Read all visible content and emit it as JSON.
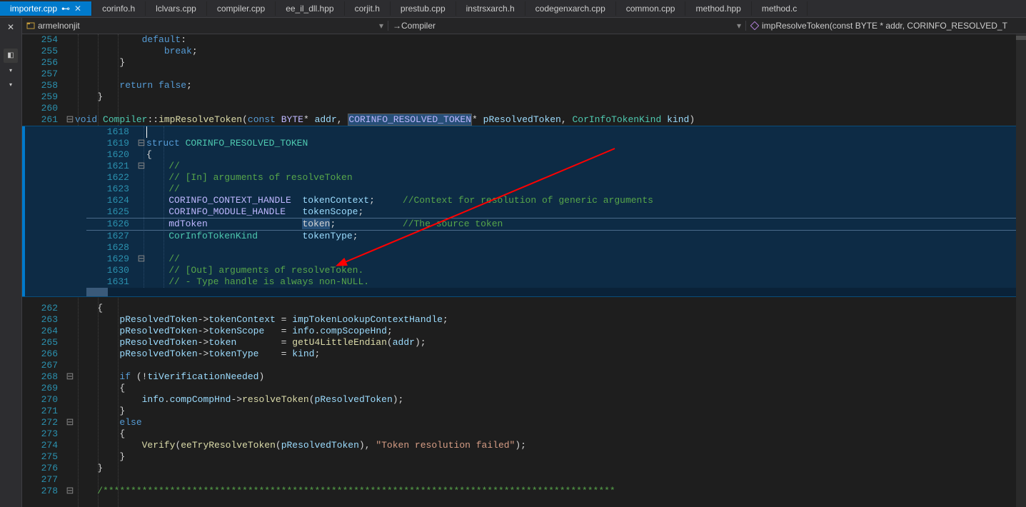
{
  "tabs": [
    {
      "label": "importer.cpp",
      "active": true,
      "pinned": true,
      "close": true
    },
    {
      "label": "corinfo.h"
    },
    {
      "label": "lclvars.cpp"
    },
    {
      "label": "compiler.cpp"
    },
    {
      "label": "ee_il_dll.hpp"
    },
    {
      "label": "corjit.h"
    },
    {
      "label": "prestub.cpp"
    },
    {
      "label": "instrsxarch.h"
    },
    {
      "label": "codegenxarch.cpp"
    },
    {
      "label": "common.cpp"
    },
    {
      "label": "method.hpp"
    },
    {
      "label": "method.c"
    }
  ],
  "nav": {
    "project": "armelnonjit",
    "class_prefix": "→ ",
    "class": "Compiler",
    "member": "impResolveToken(const BYTE * addr, CORINFO_RESOLVED_T"
  },
  "outer": {
    "lines": [
      {
        "num": "254",
        "fold": "",
        "indent": 3,
        "html": "<span class='kw'>default</span>:"
      },
      {
        "num": "255",
        "fold": "",
        "indent": 4,
        "html": "<span class='kw'>break</span>;"
      },
      {
        "num": "256",
        "fold": "",
        "indent": 2,
        "html": "}"
      },
      {
        "num": "257",
        "fold": "",
        "indent": 0,
        "html": ""
      },
      {
        "num": "258",
        "fold": "",
        "indent": 2,
        "html": "<span class='kw'>return</span> <span class='kw'>false</span>;"
      },
      {
        "num": "259",
        "fold": "",
        "indent": 1,
        "html": "}"
      },
      {
        "num": "260",
        "fold": "",
        "indent": 0,
        "html": ""
      },
      {
        "num": "261",
        "fold": "⊟",
        "indent": 0,
        "html": "<span class='kw'>void</span> <span class='type'>Compiler</span>::<span class='fn'>impResolveToken</span>(<span class='kw'>const</span> <span class='mac'>BYTE</span>* <span class='id'>addr</span>, <span class='hl'><span class='mac'>CORINFO_RESOLVED_TOKEN</span></span>* <span class='id'>pResolvedToken</span>, <span class='type'>CorInfoTokenKind</span> <span class='id'>kind</span>)"
      }
    ],
    "lines2": [
      {
        "num": "262",
        "fold": "",
        "indent": 1,
        "html": "{"
      },
      {
        "num": "263",
        "fold": "",
        "indent": 2,
        "html": "<span class='id'>pResolvedToken</span>-&gt;<span class='id'>tokenContext</span> = <span class='id'>impTokenLookupContextHandle</span>;"
      },
      {
        "num": "264",
        "fold": "",
        "indent": 2,
        "html": "<span class='id'>pResolvedToken</span>-&gt;<span class='id'>tokenScope</span>   = <span class='id'>info</span>.<span class='id'>compScopeHnd</span>;"
      },
      {
        "num": "265",
        "fold": "",
        "indent": 2,
        "html": "<span class='id'>pResolvedToken</span>-&gt;<span class='id'>token</span>        = <span class='fn'>getU4LittleEndian</span>(<span class='id'>addr</span>);"
      },
      {
        "num": "266",
        "fold": "",
        "indent": 2,
        "html": "<span class='id'>pResolvedToken</span>-&gt;<span class='id'>tokenType</span>    = <span class='id'>kind</span>;"
      },
      {
        "num": "267",
        "fold": "",
        "indent": 0,
        "html": ""
      },
      {
        "num": "268",
        "fold": "⊟",
        "indent": 2,
        "html": "<span class='kw'>if</span> (!<span class='id'>tiVerificationNeeded</span>)"
      },
      {
        "num": "269",
        "fold": "",
        "indent": 2,
        "html": "{"
      },
      {
        "num": "270",
        "fold": "",
        "indent": 3,
        "html": "<span class='id'>info</span>.<span class='id'>compCompHnd</span>-&gt;<span class='fn'>resolveToken</span>(<span class='id'>pResolvedToken</span>);"
      },
      {
        "num": "271",
        "fold": "",
        "indent": 2,
        "html": "}"
      },
      {
        "num": "272",
        "fold": "⊟",
        "indent": 2,
        "html": "<span class='kw'>else</span>"
      },
      {
        "num": "273",
        "fold": "",
        "indent": 2,
        "html": "{"
      },
      {
        "num": "274",
        "fold": "",
        "indent": 3,
        "html": "<span class='fn'>Verify</span>(<span class='fn'>eeTryResolveToken</span>(<span class='id'>pResolvedToken</span>), <span class='str'>\"Token resolution failed\"</span>);"
      },
      {
        "num": "275",
        "fold": "",
        "indent": 2,
        "html": "}"
      },
      {
        "num": "276",
        "fold": "",
        "indent": 1,
        "html": "}"
      },
      {
        "num": "277",
        "fold": "",
        "indent": 0,
        "html": ""
      },
      {
        "num": "278",
        "fold": "⊟",
        "indent": 1,
        "html": "<span class='cm'>/********************************************************************************************</span>"
      }
    ]
  },
  "peek": {
    "lines": [
      {
        "num": "1618",
        "fold": "",
        "indent": 0,
        "html": "",
        "cursor": true
      },
      {
        "num": "1619",
        "fold": "⊟",
        "indent": 0,
        "html": "<span class='kw'>struct</span> <span class='type'>CORINFO_RESOLVED_TOKEN</span>"
      },
      {
        "num": "1620",
        "fold": "",
        "indent": 0,
        "html": "{"
      },
      {
        "num": "1621",
        "fold": "⊟",
        "indent": 1,
        "html": "<span class='cm'>//</span>"
      },
      {
        "num": "1622",
        "fold": "",
        "indent": 1,
        "html": "<span class='cm'>// [In] arguments of resolveToken</span>"
      },
      {
        "num": "1623",
        "fold": "",
        "indent": 1,
        "html": "<span class='cm'>//</span>"
      },
      {
        "num": "1624",
        "fold": "",
        "indent": 1,
        "html": "<span class='mac'>CORINFO_CONTEXT_HANDLE</span>  <span class='id'>tokenContext</span>;     <span class='cm'>//Context for resolution of generic arguments</span>"
      },
      {
        "num": "1625",
        "fold": "",
        "indent": 1,
        "html": "<span class='mac'>CORINFO_MODULE_HANDLE</span>   <span class='id'>tokenScope</span>;"
      },
      {
        "num": "1626",
        "fold": "",
        "indent": 1,
        "html": "<span class='mac'>mdToken</span>                 <span class='sel'>tok</span><span class='sel'>en</span>;            <span class='cm'>//The source token</span>",
        "hl": true
      },
      {
        "num": "1627",
        "fold": "",
        "indent": 1,
        "html": "<span class='type'>CorInfoTokenKind</span>        <span class='id'>tokenType</span>;"
      },
      {
        "num": "1628",
        "fold": "",
        "indent": 0,
        "html": ""
      },
      {
        "num": "1629",
        "fold": "⊟",
        "indent": 1,
        "html": "<span class='cm'>//</span>"
      },
      {
        "num": "1630",
        "fold": "",
        "indent": 1,
        "html": "<span class='cm'>// [Out] arguments of resolveToken.</span>"
      },
      {
        "num": "1631",
        "fold": "",
        "indent": 1,
        "html": "<span class='cm'>// - Type handle is always non-NULL.</span>"
      }
    ]
  }
}
